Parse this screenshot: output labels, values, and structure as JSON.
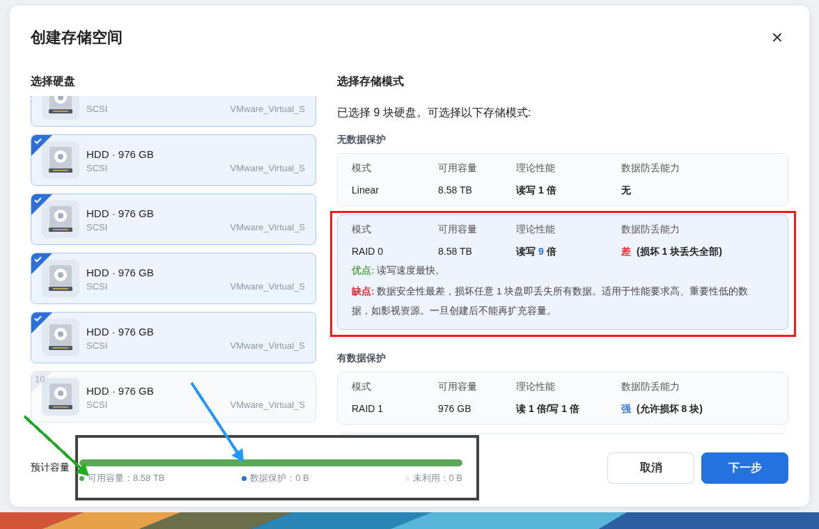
{
  "dialog": {
    "title": "创建存储空间",
    "close": "×"
  },
  "disks": {
    "heading": "选择硬盘",
    "items": [
      {
        "bus": "SCSI",
        "model": "VMware_Virtual_S",
        "selected": true
      },
      {
        "title": "HDD · 976 GB",
        "bus": "SCSI",
        "model": "VMware_Virtual_S",
        "selected": true
      },
      {
        "title": "HDD · 976 GB",
        "bus": "SCSI",
        "model": "VMware_Virtual_S",
        "selected": true
      },
      {
        "title": "HDD · 976 GB",
        "bus": "SCSI",
        "model": "VMware_Virtual_S",
        "selected": true
      },
      {
        "title": "HDD · 976 GB",
        "bus": "SCSI",
        "model": "VMware_Virtual_S",
        "selected": true
      },
      {
        "title": "HDD · 976 GB",
        "bus": "SCSI",
        "model": "VMware_Virtual_S",
        "selected": false,
        "slot": "10"
      }
    ]
  },
  "modes": {
    "heading": "选择存储模式",
    "summary": "已选择 9 块硬盘。可选择以下存储模式:",
    "groups": [
      {
        "title": "无数据保护",
        "items": [
          {
            "columns": [
              "模式",
              "可用容量",
              "理论性能",
              "数据防丢能力"
            ],
            "name": "Linear",
            "capacity": "8.58 TB",
            "performance": [
              {
                "text": "读写 1 倍"
              }
            ],
            "loss": {
              "text": "无"
            },
            "selected": false
          },
          {
            "columns": [
              "模式",
              "可用容量",
              "理论性能",
              "数据防丢能力"
            ],
            "name": "RAID 0",
            "capacity": "8.58 TB",
            "performance": [
              {
                "text": "读写 "
              },
              {
                "text": "9",
                "highlight": true
              },
              {
                "text": " 倍"
              }
            ],
            "loss": {
              "text": "差",
              "color": "#e8222a",
              "note": "(损坏 1 块丢失全部)"
            },
            "selected": true,
            "notes": [
              {
                "kind": "pros",
                "text": "**优点:** 读写速度最快。"
              },
              {
                "kind": "cons",
                "text": "**缺点:** 数据安全性最差，损坏任意 1 块盘即丢失所有数据。适用于性能要求高、重要性低的数据，如影视资源。一旦创建后不能再扩充容量。"
              }
            ]
          }
        ]
      },
      {
        "title": "有数据保护",
        "more_below": true,
        "items": [
          {
            "columns": [
              "模式",
              "可用容量",
              "理论性能",
              "数据防丢能力"
            ],
            "name": "RAID 1",
            "capacity": "976 GB",
            "performance": [
              {
                "text": "读 1 倍/写 1 倍"
              }
            ],
            "loss": {
              "text": "强",
              "color": "#2a6fdb",
              "note": "(允许损坏 8 块)"
            },
            "selected": false
          }
        ]
      }
    ]
  },
  "estimate": {
    "label": "预计容量",
    "level": 1,
    "legend": [
      {
        "label": "可用容量：8.58 TB",
        "color": "#5aa858"
      },
      {
        "label": "数据保护：0 B",
        "color": "#2a6fdb"
      },
      {
        "label": "未利用：0 B",
        "color": "#eceef2"
      }
    ]
  },
  "buttons": [
    {
      "label": "取消",
      "kind": "secondary"
    },
    {
      "label": "下一步",
      "kind": "primary"
    }
  ],
  "annotations": [
    {
      "kind": "frame",
      "color": "#f01c1c"
    },
    {
      "kind": "frame",
      "color": "#444444"
    },
    {
      "kind": "arrow",
      "color": "#22aa22"
    },
    {
      "kind": "arrow",
      "color": "#2299ff"
    }
  ]
}
